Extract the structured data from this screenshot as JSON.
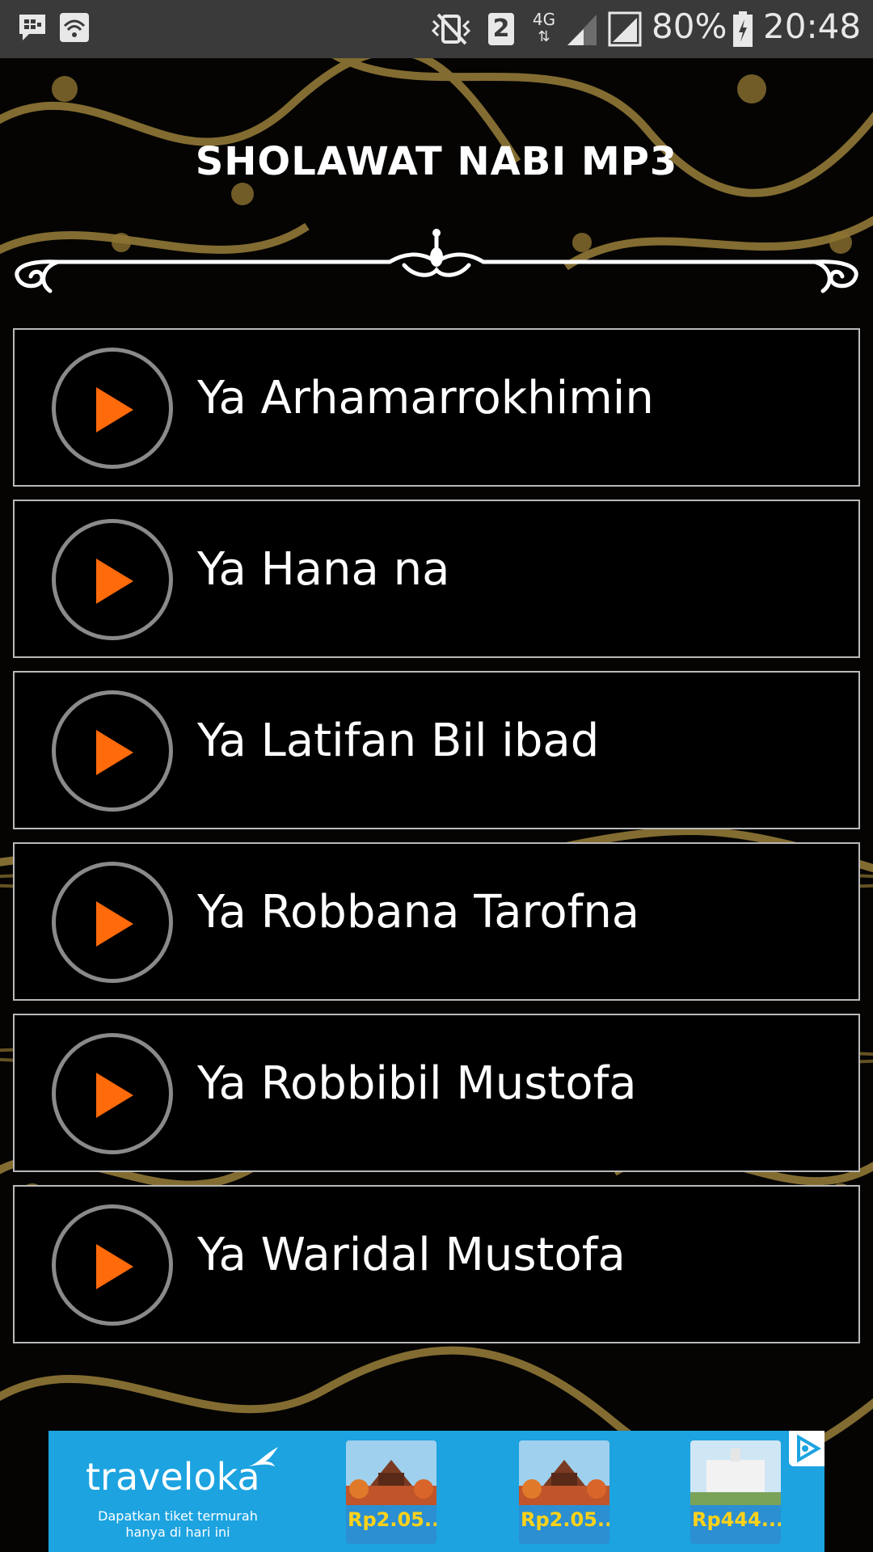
{
  "status_bar": {
    "battery": "80%",
    "time": "20:48",
    "sim_slot": "2",
    "network": "4G",
    "icons": [
      "bbm-icon",
      "wifi-icon",
      "vibrate-icon",
      "sim-2-icon",
      "4g-icon",
      "signal-icon",
      "signal-icon",
      "battery-charging-icon"
    ]
  },
  "header": {
    "title": "SHOLAWAT NABI MP3"
  },
  "songs": [
    {
      "title": ""
    },
    {
      "title": "Ya Arhamarrokhimin"
    },
    {
      "title": "Ya Hana na"
    },
    {
      "title": "Ya Latifan Bil ibad"
    },
    {
      "title": "Ya Robbana Tarofna"
    },
    {
      "title": "Ya Robbibil Mustofa"
    },
    {
      "title": "Ya Waridal Mustofa"
    }
  ],
  "ad": {
    "brand": "traveloka",
    "tagline": "Dapatkan tiket termurah hanya di hari ini",
    "cards": [
      {
        "price": "Rp2.05..."
      },
      {
        "price": "Rp2.05..."
      },
      {
        "price": "Rp444...."
      }
    ]
  },
  "colors": {
    "accent_play": "#ff6a0a",
    "ad_background": "#1ca3e0",
    "ad_price": "#ffd21a",
    "ornament_gold": "#a6893e"
  }
}
